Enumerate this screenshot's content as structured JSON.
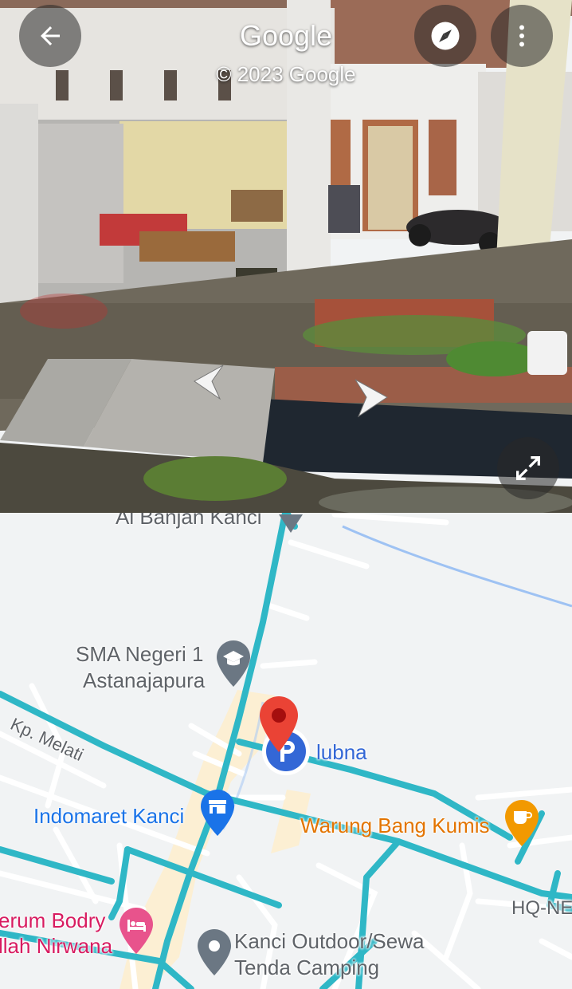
{
  "street_view": {
    "title": "Google",
    "copyright": "© 2023 Google",
    "icons": {
      "back": "arrow-left-icon",
      "compass": "compass-icon",
      "menu": "more-vert-icon",
      "expand": "expand-icon",
      "prev": "chevron-left-icon",
      "next": "chevron-right-icon"
    }
  },
  "map": {
    "places": {
      "partial_top": "Al Banjan Kanci",
      "school_line1": "SMA Negeri 1",
      "school_line2": "Astanajapura",
      "street": "Kp. Melati",
      "parking": "lubna",
      "store": "Indomaret Kanci",
      "cafe": "Warung Bang Kumis",
      "edge_right": "HQ-NE",
      "lodging_line1": "erum Bodry",
      "lodging_line2": "llah Nirwana",
      "outdoor_line1": "Kanci Outdoor/Sewa",
      "outdoor_line2": "Tenda Camping"
    },
    "colors": {
      "road_highlight": "#2fb7c6",
      "school": "#5f6368",
      "parking": "#3367d6",
      "store": "#1a73e8",
      "cafe": "#e37400",
      "lodging": "#d81b60",
      "pin": "#ea4335"
    }
  }
}
